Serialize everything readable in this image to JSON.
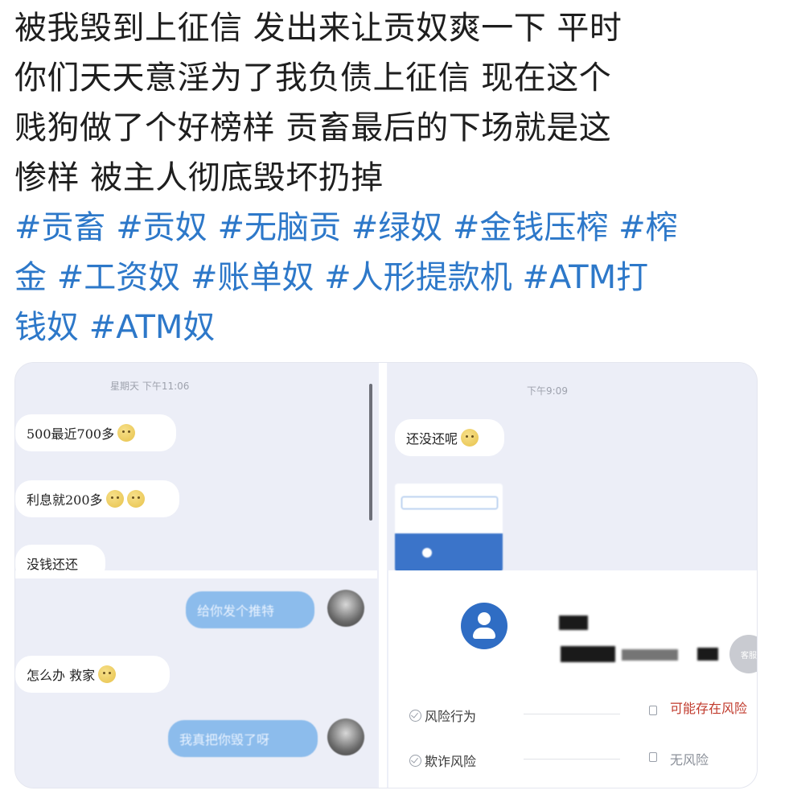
{
  "post": {
    "lines": [
      "被我毁到上征信 发出来让贡奴爽一下 平时",
      "你们天天意淫为了我负债上征信 现在这个",
      "贱狗做了个好榜样 贡畜最后的下场就是这",
      "惨样 被主人彻底毁坏扔掉"
    ],
    "tag_lines": [
      "#贡畜 #贡奴 #无脑贡 #绿奴 #金钱压榨 #榨",
      "金 #工资奴 #账单奴 #人形提款机 #ATM打",
      "钱奴 #ATM奴"
    ]
  },
  "screenshot": {
    "left_top": {
      "timestamp": "星期天 下午11:06",
      "messages": [
        "500最近700多",
        "利息就200多",
        "没钱还还"
      ]
    },
    "right_top": {
      "timestamp": "下午9:09",
      "messages": [
        "还没还呢"
      ]
    },
    "left_bottom": {
      "messages": [
        "给你发个推特",
        "怎么办 救家",
        "我真把你毁了呀"
      ]
    },
    "right_bottom": {
      "fab_label": "客服",
      "rows": [
        {
          "label": "风险行为",
          "status": "可能存在风险",
          "status_color": "#c0392b"
        },
        {
          "label": "欺诈风险",
          "status": "无风险",
          "status_color": "#8a8f98"
        }
      ]
    }
  },
  "colors": {
    "tag_blue": "#2d78c9",
    "chat_bubble_blue": "#8cbcec",
    "profile_blue": "#2f6dc4"
  }
}
